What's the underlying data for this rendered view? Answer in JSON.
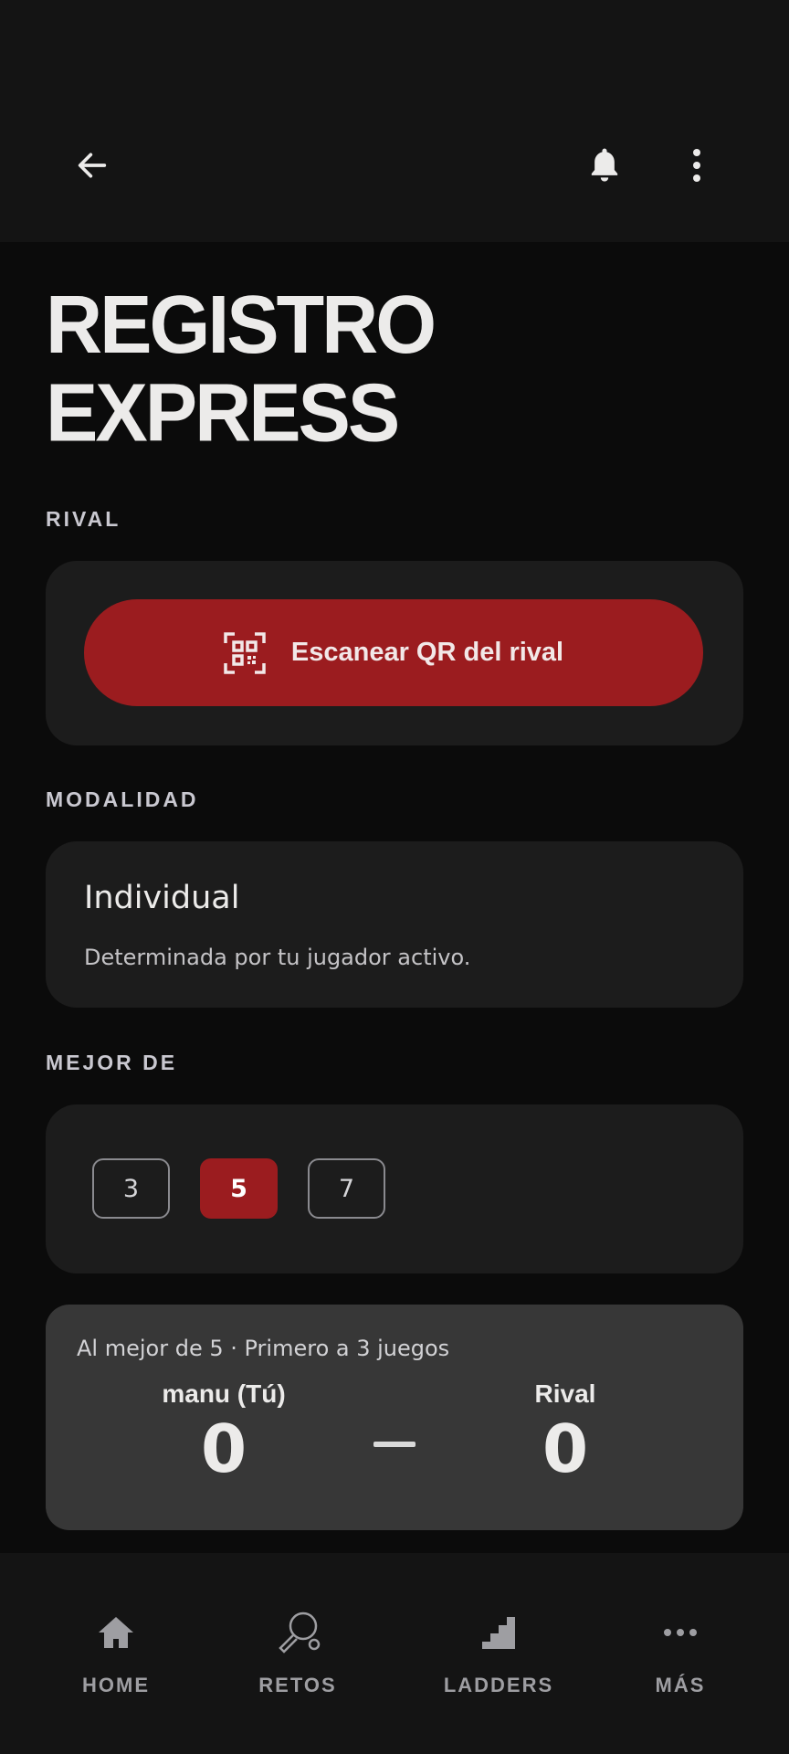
{
  "header": {
    "title_line1": "REGISTRO",
    "title_line2": "EXPRESS"
  },
  "rival_section": {
    "label": "RIVAL",
    "scan_button_label": "Escanear QR del rival"
  },
  "modalidad_section": {
    "label": "MODALIDAD",
    "value": "Individual",
    "description": "Determinada por tu jugador activo."
  },
  "mejor_de_section": {
    "label": "MEJOR DE",
    "options": [
      "3",
      "5",
      "7"
    ],
    "selected": "5"
  },
  "score": {
    "summary": "Al mejor de 5 · Primero a 3 juegos",
    "player_name": "manu (Tú)",
    "player_score": "0",
    "rival_name": "Rival",
    "rival_score": "0"
  },
  "bottom_nav": {
    "items": [
      {
        "label": "HOME",
        "icon": "home-icon"
      },
      {
        "label": "RETOS",
        "icon": "ping-pong-paddle-icon"
      },
      {
        "label": "LADDERS",
        "icon": "stairs-icon"
      },
      {
        "label": "MÁS",
        "icon": "more-horizontal-icon"
      }
    ]
  },
  "colors": {
    "accent": "#9b1c1f",
    "background": "#0b0b0b",
    "card": "#1c1c1c",
    "score_card": "#373737"
  }
}
